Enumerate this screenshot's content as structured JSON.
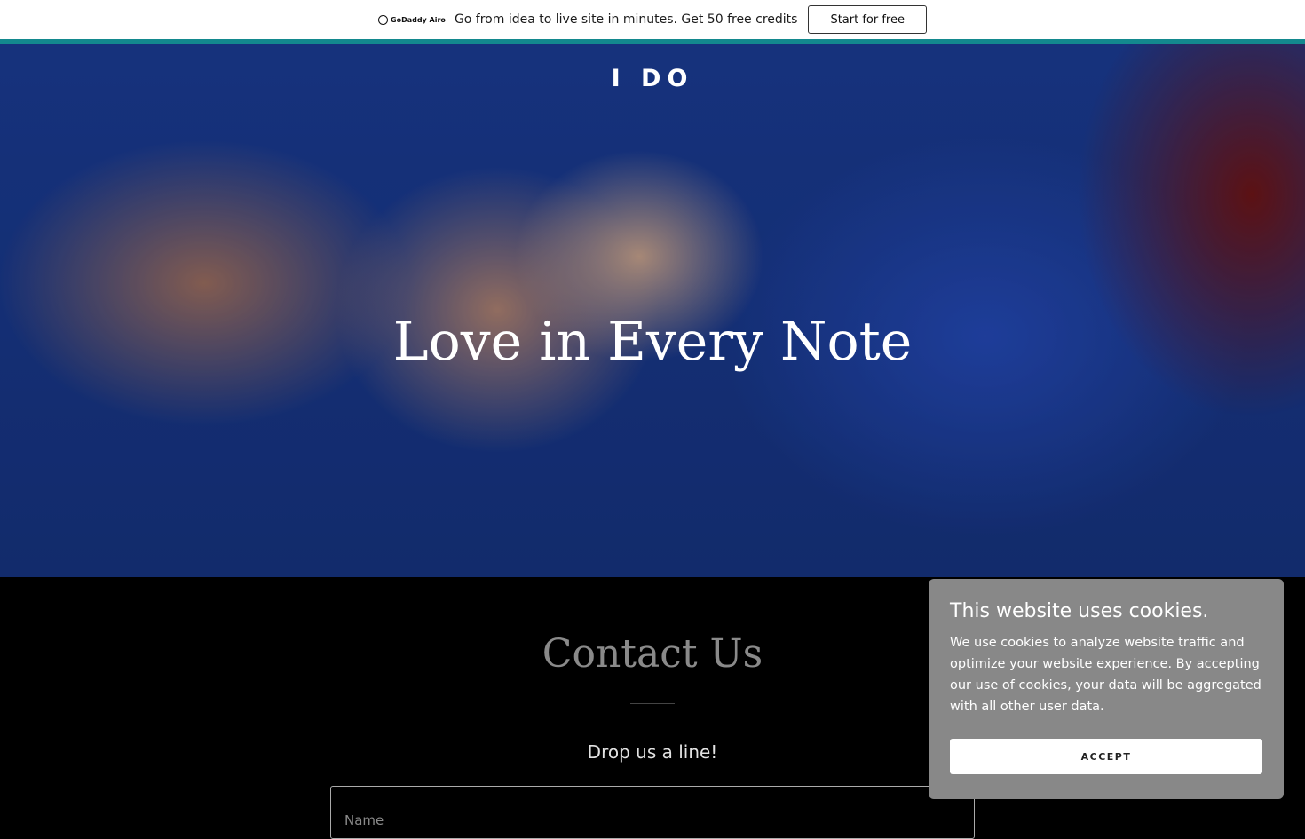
{
  "promo_bar": {
    "brand": "GoDaddy Airo",
    "text": "Go from idea to live site in minutes. Get 50 free credits",
    "button_label": "Start for free",
    "accent_color": "#13898e"
  },
  "hero": {
    "logo": "I DO",
    "title": "Love in Every Note"
  },
  "contact": {
    "heading": "Contact Us",
    "subheading": "Drop us a line!",
    "name_placeholder": "Name"
  },
  "cookie_banner": {
    "title": "This website uses cookies.",
    "body": "We use cookies to analyze website traffic and optimize your website experience. By accepting our use of cookies, your data will be aggregated with all other user data.",
    "accept_label": "ACCEPT",
    "background_color": "#888888"
  }
}
